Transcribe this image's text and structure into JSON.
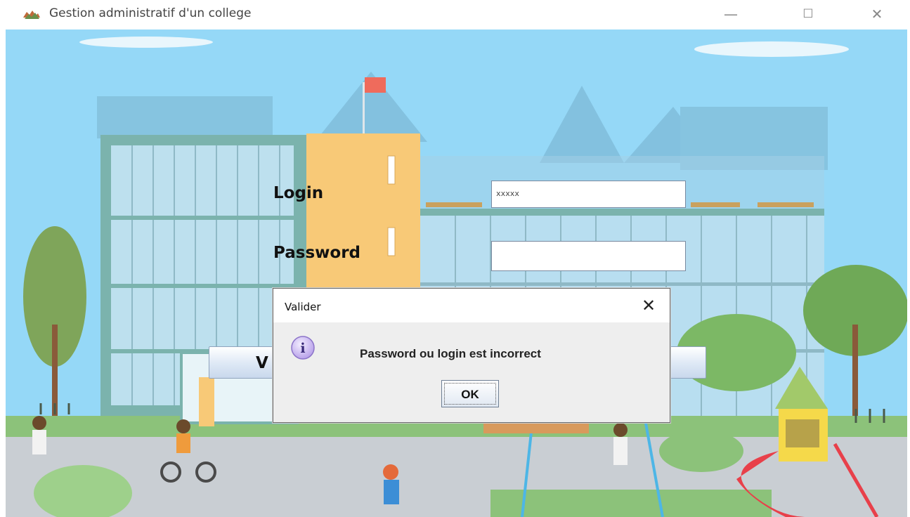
{
  "window": {
    "title": "Gestion administratif d'un college",
    "app_icon": "map-icon",
    "controls": {
      "minimize": "—",
      "maximize": "☐",
      "close": "✕"
    }
  },
  "form": {
    "login_label": "Login",
    "login_value": "xxxxx",
    "password_label": "Password",
    "password_value": "",
    "validate_button_label": "V"
  },
  "dialog": {
    "title": "Valider",
    "close": "✕",
    "icon": "info-icon",
    "icon_glyph": "i",
    "message": "Password ou login est incorrect",
    "ok_label": "OK"
  },
  "colors": {
    "sky": "#8fd3f4",
    "dialog_bg": "#eeeeee",
    "info_icon": "#c9b6f0"
  }
}
